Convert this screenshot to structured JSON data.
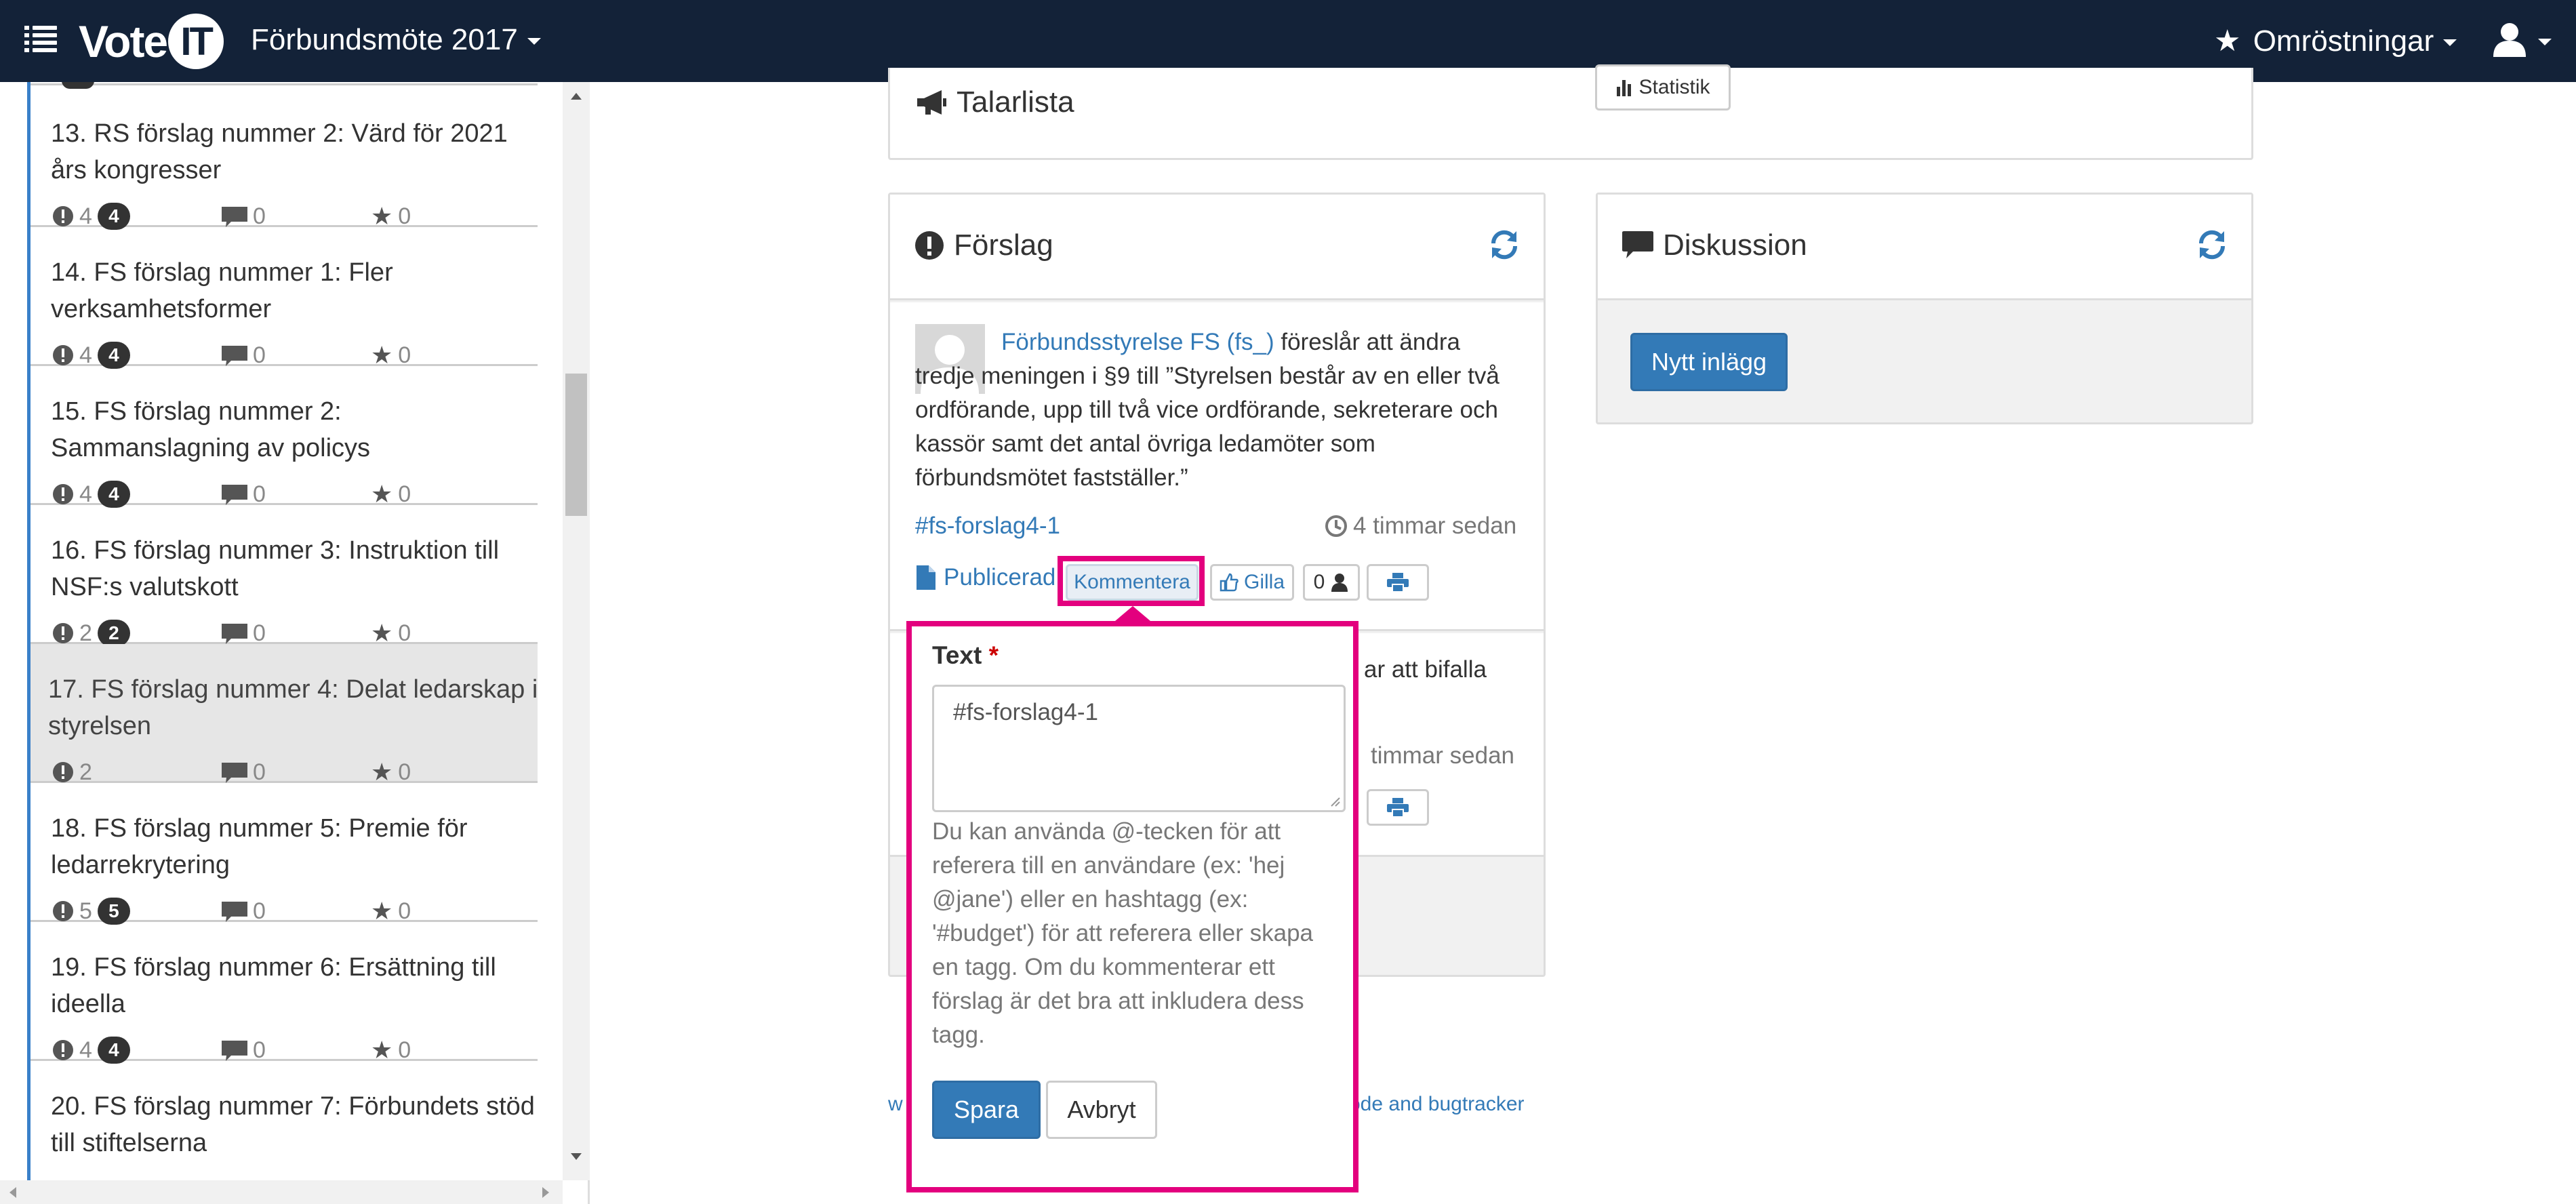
{
  "header": {
    "logo_text": "Vote",
    "logo_circle": "IT",
    "meeting_title": "Förbundsmöte 2017",
    "polls_label": "Omröstningar"
  },
  "sidebar": {
    "items": [
      {
        "title": "13. RS förslag nummer 2: Värd för 2021 års kongresser",
        "proposals": "4",
        "badge": "4",
        "comments": "0",
        "stars": "0"
      },
      {
        "title": "14. FS förslag nummer 1: Fler verksamhetsformer",
        "proposals": "4",
        "badge": "4",
        "comments": "0",
        "stars": "0"
      },
      {
        "title": "15. FS förslag nummer 2: Sammanslagning av policys",
        "proposals": "4",
        "badge": "4",
        "comments": "0",
        "stars": "0"
      },
      {
        "title": "16. FS förslag nummer 3: Instruktion till NSF:s valutskott",
        "proposals": "2",
        "badge": "2",
        "comments": "0",
        "stars": "0"
      },
      {
        "title": "17. FS förslag nummer 4: Delat ledarskap i styrelsen",
        "proposals": "2",
        "badge": "",
        "comments": "0",
        "stars": "0"
      },
      {
        "title": "18. FS förslag nummer 5: Premie för ledarrekrytering",
        "proposals": "5",
        "badge": "5",
        "comments": "0",
        "stars": "0"
      },
      {
        "title": "19. FS förslag nummer 6: Ersättning till ideella",
        "proposals": "4",
        "badge": "4",
        "comments": "0",
        "stars": "0"
      },
      {
        "title": "20. FS förslag nummer 7: Förbundets stöd till stiftelserna",
        "proposals": "",
        "badge": "",
        "comments": "",
        "stars": ""
      }
    ]
  },
  "speakers": {
    "title": "Talarlista",
    "stats_label": "Statistik"
  },
  "proposals_panel": {
    "title": "Förslag",
    "proposal": {
      "author": "Förbundsstyrelse FS (fs_)",
      "text": " föreslår att ändra tredje meningen i §9 till ”Styrelsen består av en eller två ordförande, upp till två vice ordförande, sekreterare och kassör samt det antal övriga ledamöter som förbundsmötet fastställer.”",
      "tag": "#fs-forslag4-1",
      "time": "4 timmar sedan",
      "status": "Publicerad",
      "comment_label": "Kommentera",
      "like_label": "Gilla",
      "like_count": "0"
    },
    "second_fragment": "ar att bifalla",
    "second_time": "timmar sedan"
  },
  "discussion": {
    "title": "Diskussion",
    "new_post": "Nytt inlägg"
  },
  "comment_form": {
    "label": "Text",
    "required": "*",
    "value": "#fs-forslag4-1",
    "help": "Du kan använda @-tecken för att referera till en användare (ex: 'hej @jane') eller en hashtagg (ex: '#budget') för att referera eller skapa en tagg. Om du kommenterar ett förslag är det bra att inkludera dess tagg.",
    "save": "Spara",
    "cancel": "Avbryt"
  },
  "footer": {
    "left_fragment": "w",
    "right_fragment": "ode and bugtracker"
  }
}
